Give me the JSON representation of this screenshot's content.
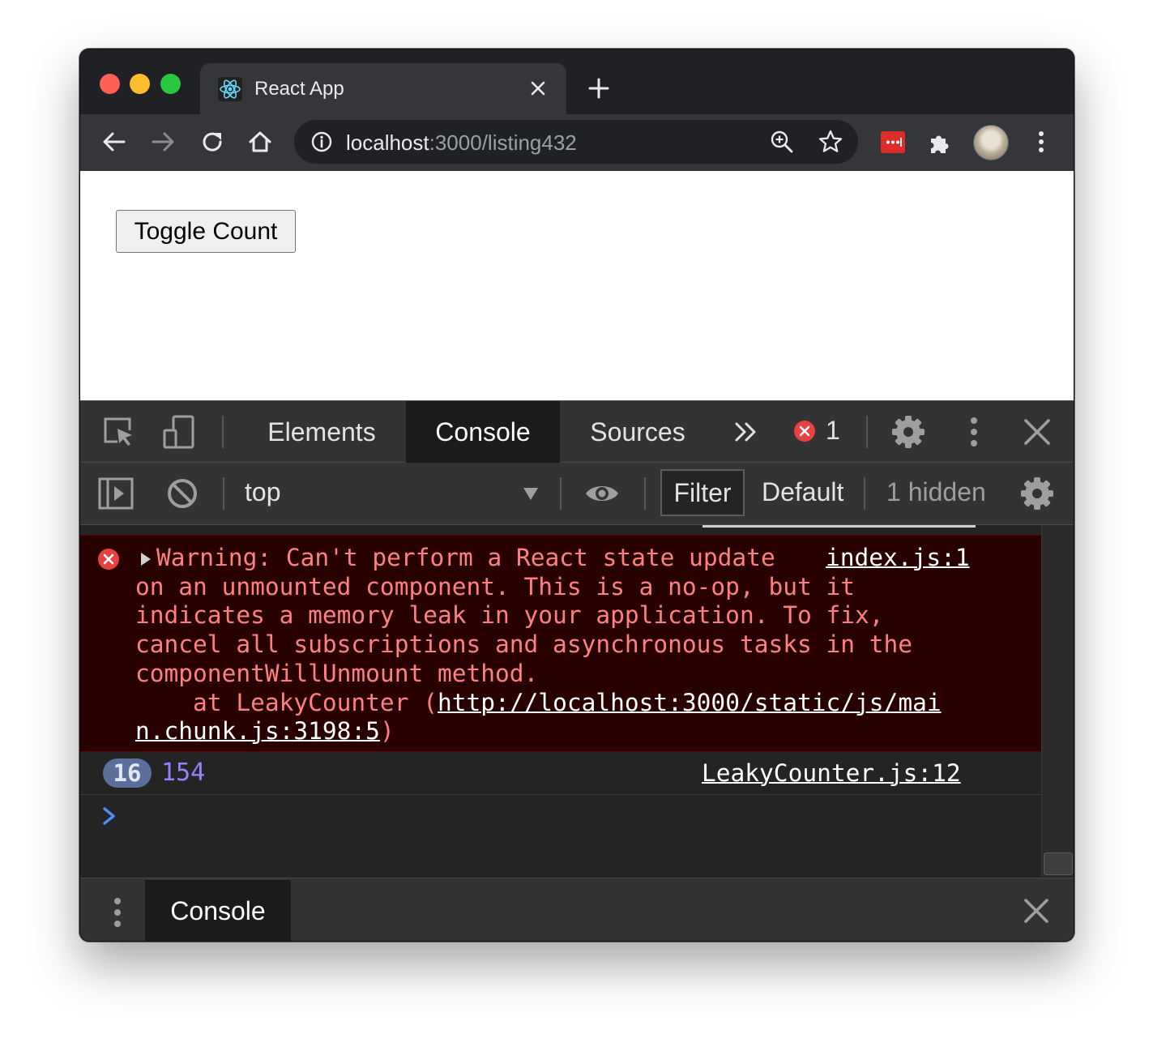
{
  "browser": {
    "tab_title": "React App",
    "url_host": "localhost",
    "url_path": ":3000/listing432"
  },
  "page": {
    "toggle_button_label": "Toggle Count"
  },
  "devtools": {
    "tabs": [
      {
        "label": "Elements",
        "active": false
      },
      {
        "label": "Console",
        "active": true
      },
      {
        "label": "Sources",
        "active": false
      }
    ],
    "error_count": "1",
    "context_selector": "top",
    "filter_placeholder": "Filter",
    "levels_label": "Default levels",
    "hidden_text": "1 hidden",
    "error_message": {
      "line1": "Warning: Can't perform a React state update ",
      "source": "index.js:1",
      "line2": "on an unmounted component. This is a no-op, but it",
      "line3": "indicates a memory leak in your application. To fix,",
      "line4": "cancel all subscriptions and asynchronous tasks in the",
      "line5": "componentWillUnmount method.",
      "line6_prefix": "    at LeakyCounter (",
      "stack_url_part1": "http://localhost:3000/static/js/mai",
      "stack_url_part2": "n.chunk.js:3198:5",
      "line7_suffix": ")"
    },
    "log_entry": {
      "repeat_count": "16",
      "value": "154",
      "source": "LeakyCounter.js:12"
    },
    "drawer_tab": "Console"
  },
  "colors": {
    "error_text": "#ff8080",
    "error_bg": "#290000",
    "log_number": "#9980ff",
    "accent_blue": "#4c8df6"
  }
}
